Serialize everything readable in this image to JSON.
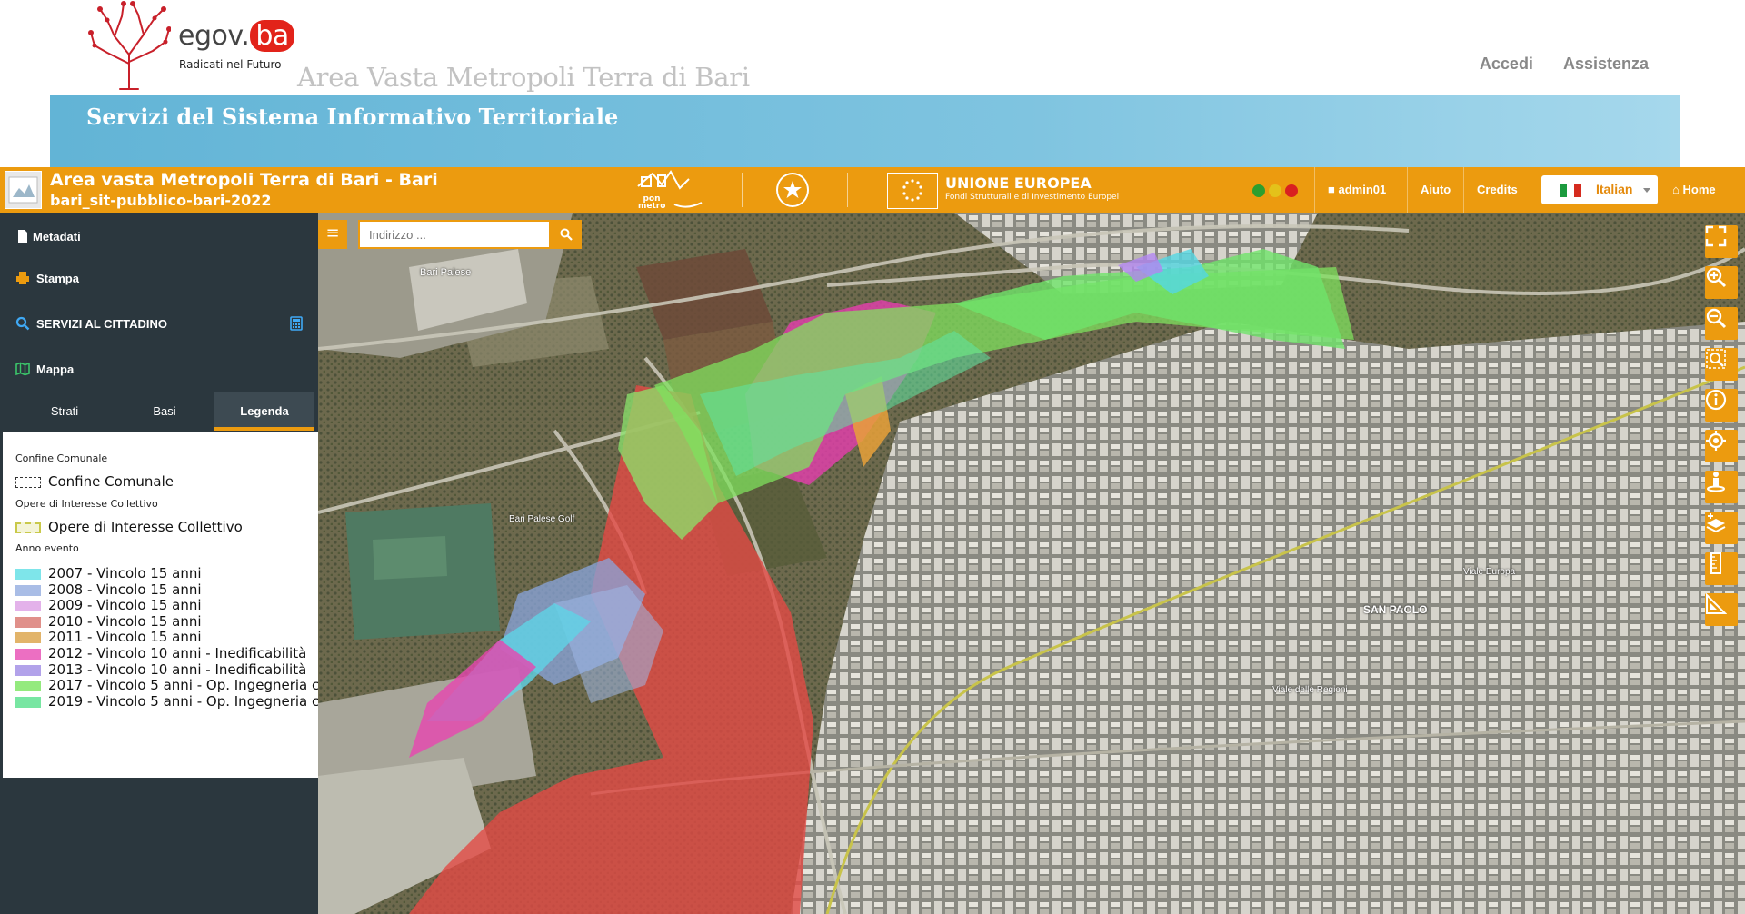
{
  "header": {
    "logo_word": "egov.",
    "logo_accent": "ba",
    "logo_tagline": "Radicati nel Futuro",
    "region_title": "Area Vasta Metropoli Terra di Bari",
    "links": [
      "Accedi",
      "Assistenza"
    ],
    "banner_title": "Servizi del Sistema Informativo Territoriale"
  },
  "toolbar": {
    "app_title": "Area vasta Metropoli Terra di Bari - Bari",
    "app_subtitle": "bari_sit-pubblico-bari-2022",
    "pon_label": "pon metro",
    "eu_title": "UNIONE EUROPEA",
    "eu_subtitle": "Fondi Strutturali e di Investimento Europei",
    "status_colors": [
      "#2e9e2e",
      "#e4c21a",
      "#d92020"
    ],
    "user": "admin01",
    "help": "Aiuto",
    "credits": "Credits",
    "language": "Italian",
    "home": "Home"
  },
  "sidebar": {
    "metadata": "Metadati",
    "print": "Stampa",
    "citizen_services": "SERVIZI AL CITTADINO",
    "map": "Mappa",
    "tabs": [
      "Strati",
      "Basi",
      "Legenda"
    ],
    "active_tab": "Legenda"
  },
  "legend": {
    "section1": "Confine Comunale",
    "item1": "Confine Comunale",
    "section2": "Opere di Interesse Collettivo",
    "item2": "Opere di Interesse Collettivo",
    "section3": "Anno evento",
    "years": [
      {
        "label": "2007 - Vincolo 15 anni",
        "color": "#7ee5ea"
      },
      {
        "label": "2008 - Vincolo 15 anni",
        "color": "#a9bde6"
      },
      {
        "label": "2009 - Vincolo 15 anni",
        "color": "#e3b2ea"
      },
      {
        "label": "2010 - Vincolo 15 anni",
        "color": "#e0908a"
      },
      {
        "label": "2011 - Vincolo 15 anni",
        "color": "#e2b46a"
      },
      {
        "label": "2012 - Vincolo 10 anni - Inedificabilità",
        "color": "#ec6fc2"
      },
      {
        "label": "2013 - Vincolo 10 anni - Inedificabilità",
        "color": "#b2a2ea"
      },
      {
        "label": "2017 - Vincolo 5 anni - Op. Ingegneria c",
        "color": "#94ea7e"
      },
      {
        "label": "2019 - Vincolo 5 anni - Op. Ingegneria c",
        "color": "#78e6a2"
      }
    ]
  },
  "map": {
    "search_placeholder": "Indirizzo ...",
    "labels": {
      "airport": "Bari Palese",
      "golf": "Bari Palese Golf",
      "san_paolo": "SAN PAOLO",
      "viale_europa": "Viale Europa",
      "viale_regioni": "Viale delle Regioni"
    },
    "tools": [
      "fullscreen-icon",
      "zoom-in-icon",
      "zoom-out-icon",
      "zoom-extent-icon",
      "info-icon",
      "locate-icon",
      "streetview-icon",
      "layers-add-icon",
      "measure-length-icon",
      "measure-area-icon"
    ]
  }
}
